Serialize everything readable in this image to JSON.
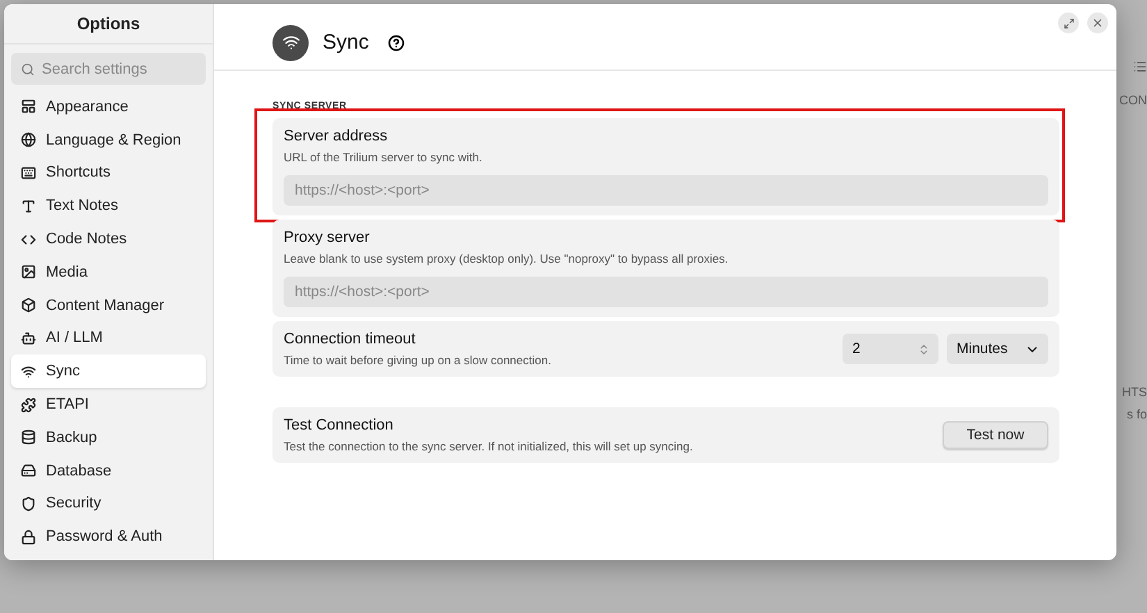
{
  "sidebar": {
    "title": "Options",
    "search": {
      "placeholder": "Search settings"
    },
    "items": [
      {
        "label": "Appearance",
        "selected": false
      },
      {
        "label": "Language & Region",
        "selected": false
      },
      {
        "label": "Shortcuts",
        "selected": false
      },
      {
        "label": "Text Notes",
        "selected": false
      },
      {
        "label": "Code Notes",
        "selected": false
      },
      {
        "label": "Media",
        "selected": false
      },
      {
        "label": "Content Manager",
        "selected": false
      },
      {
        "label": "AI / LLM",
        "selected": false
      },
      {
        "label": "Sync",
        "selected": true
      },
      {
        "label": "ETAPI",
        "selected": false
      },
      {
        "label": "Backup",
        "selected": false
      },
      {
        "label": "Database",
        "selected": false
      },
      {
        "label": "Security",
        "selected": false
      },
      {
        "label": "Password & Auth",
        "selected": false
      }
    ]
  },
  "page": {
    "title": "Sync",
    "section": "SYNC SERVER",
    "settings": [
      {
        "kind": "text",
        "label": "Server address",
        "description": "URL of the Trilium server to sync with.",
        "placeholder": "https://<host>:<port>",
        "highlighted": true
      },
      {
        "kind": "text",
        "label": "Proxy server",
        "description": "Leave blank to use system proxy (desktop only). Use \"noproxy\" to bypass all proxies.",
        "placeholder": "https://<host>:<port>",
        "highlighted": false
      },
      {
        "kind": "timeout",
        "label": "Connection timeout",
        "description": "Time to wait before giving up on a slow connection.",
        "value": "2",
        "unit": "Minutes",
        "highlighted": false
      }
    ],
    "test": {
      "label": "Test Connection",
      "description": "Test the connection to the sync server. If not initialized, this will set up syncing.",
      "button": "Test now"
    }
  },
  "backdrop": {
    "texts": [
      "CON",
      "HTS",
      "s fo"
    ]
  }
}
